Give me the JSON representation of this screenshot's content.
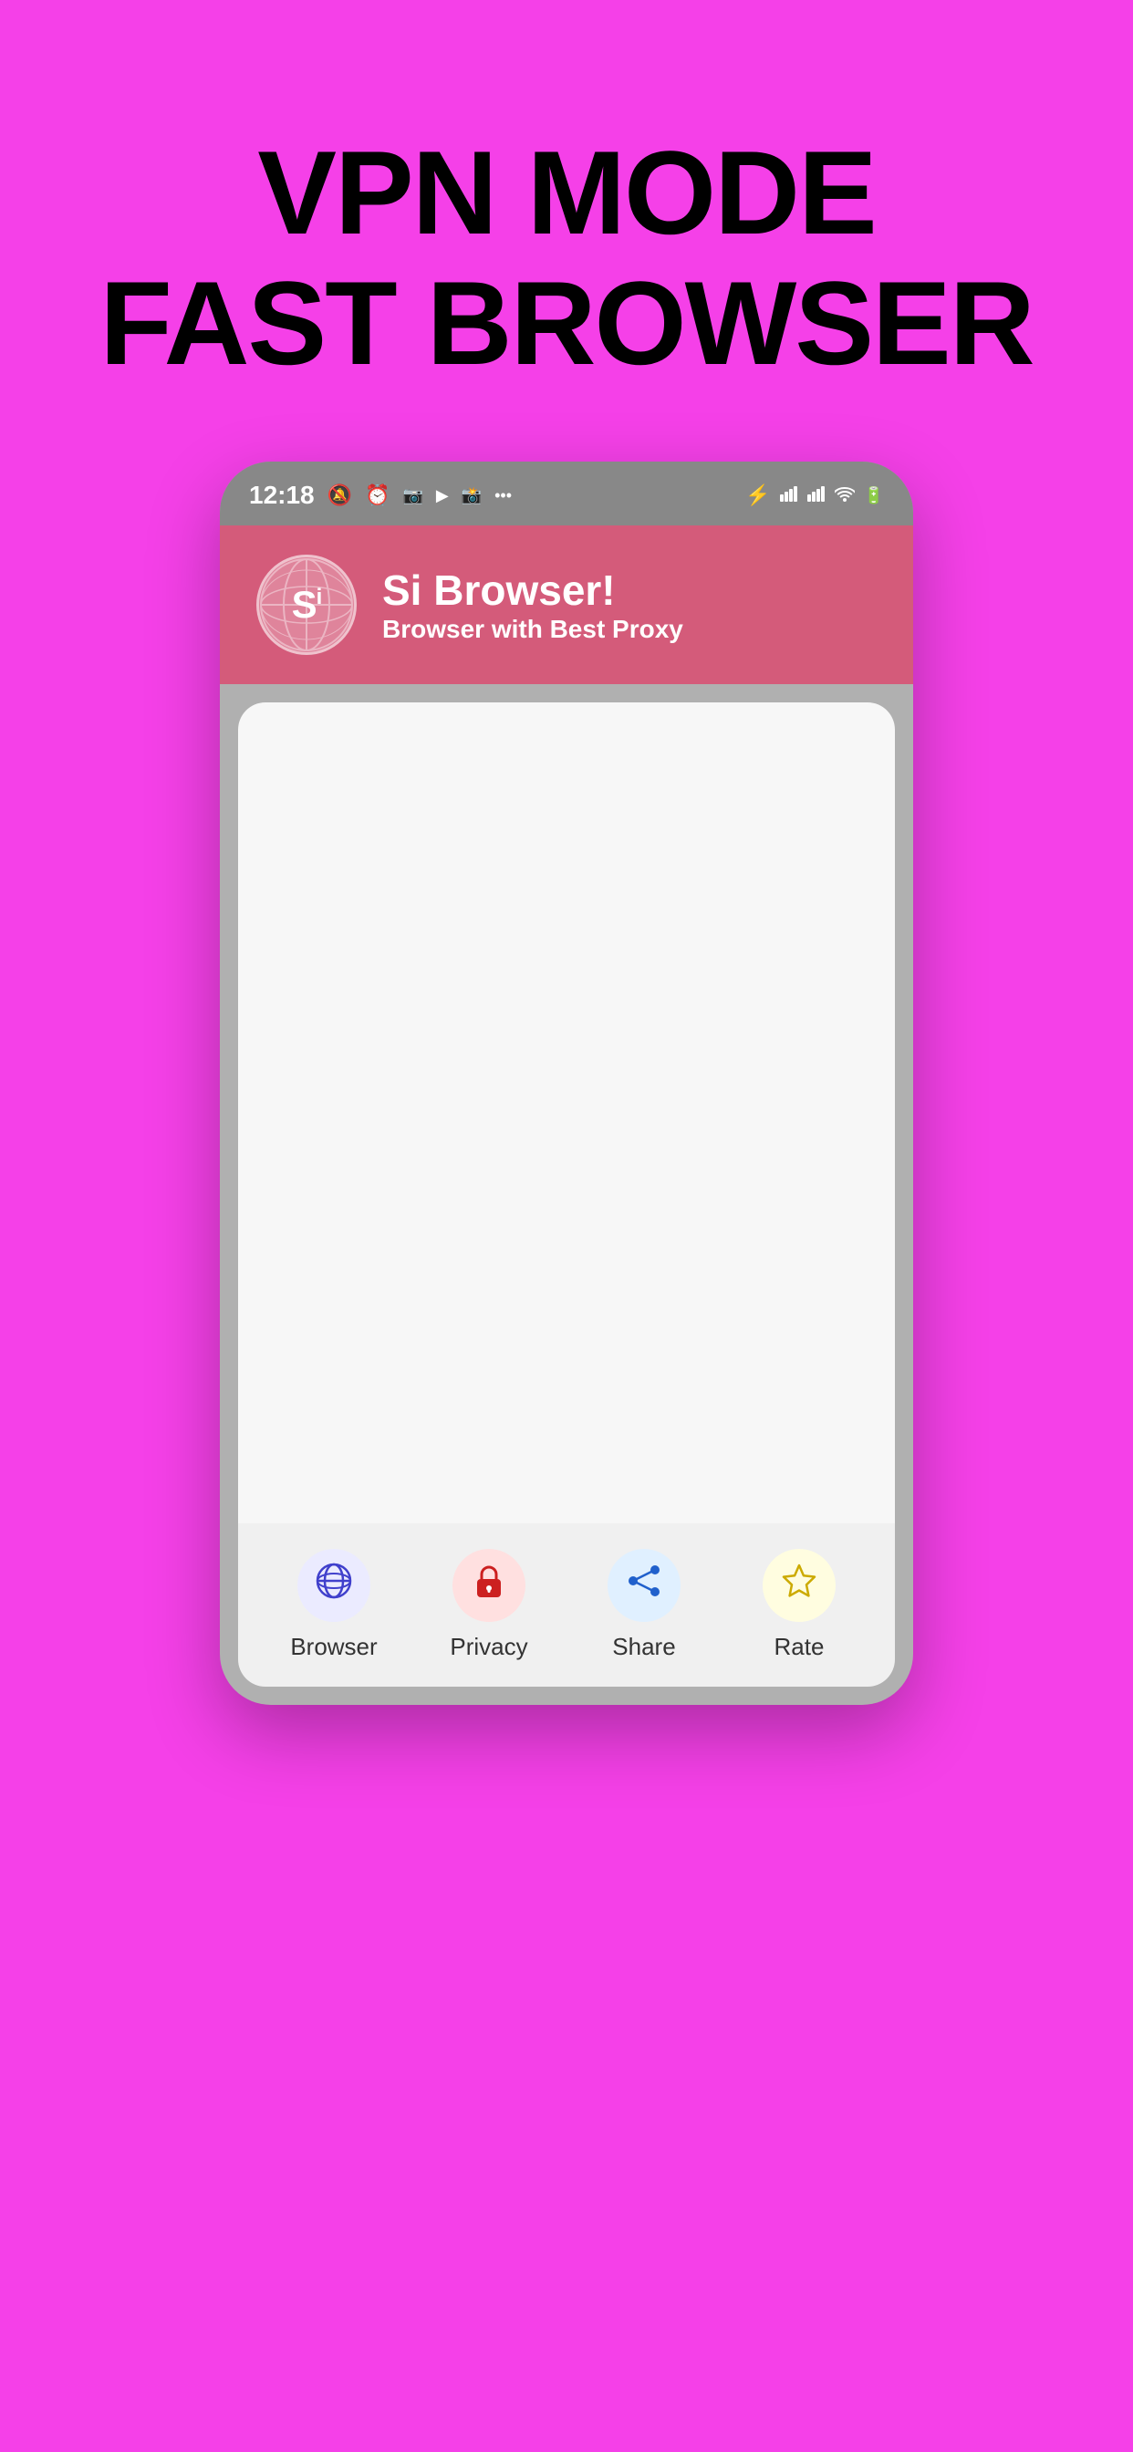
{
  "background": {
    "color": "#f540e8"
  },
  "hero": {
    "line1": "VPN MODE",
    "line2": "FAST BROWSER"
  },
  "phone": {
    "statusBar": {
      "time": "12:18",
      "leftIcons": [
        "🔕",
        "⏰",
        "📷",
        "▶",
        "📷",
        "···"
      ],
      "rightIcons": [
        "⚡",
        "📶",
        "📶",
        "📶",
        "🔋"
      ]
    },
    "appHeader": {
      "appName": "Si Browser!",
      "appSubtitle": "Browser with Best Proxy",
      "logoText": "Si"
    },
    "bottomNav": {
      "items": [
        {
          "id": "browser",
          "label": "Browser",
          "iconType": "globe",
          "iconColor": "#4040cc"
        },
        {
          "id": "privacy",
          "label": "Privacy",
          "iconType": "lock",
          "iconColor": "#cc2020"
        },
        {
          "id": "share",
          "label": "Share",
          "iconType": "share",
          "iconColor": "#2060cc"
        },
        {
          "id": "rate",
          "label": "Rate",
          "iconType": "star",
          "iconColor": "#ccaa00"
        }
      ]
    }
  }
}
